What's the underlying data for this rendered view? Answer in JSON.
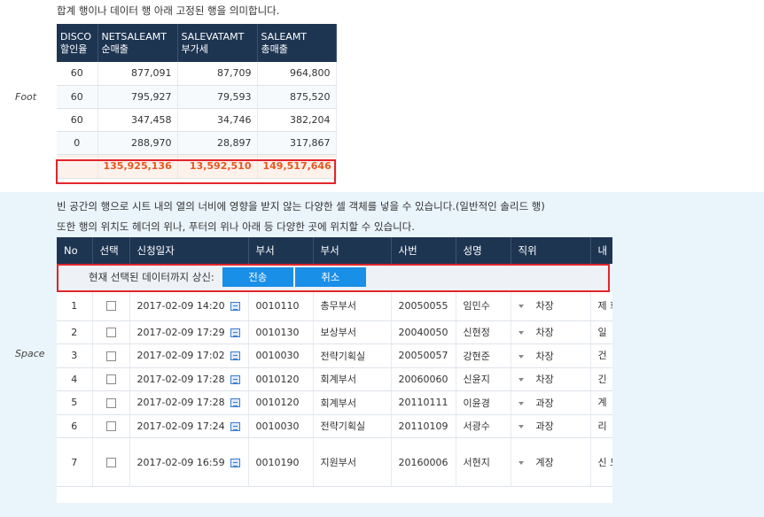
{
  "foot": {
    "section_label": "Foot",
    "description": "합계 행이나 데이터 행 아래 고정된 행을 의미합니다.",
    "headers": [
      {
        "line1": "DISCO",
        "line2": "할인율"
      },
      {
        "line1": "NETSALEAMT",
        "line2": "순매출"
      },
      {
        "line1": "SALEVATAMT",
        "line2": "부가세"
      },
      {
        "line1": "SALEAMT",
        "line2": "총매출"
      }
    ],
    "rows": [
      [
        "60",
        "877,091",
        "87,709",
        "964,800"
      ],
      [
        "60",
        "795,927",
        "79,593",
        "875,520"
      ],
      [
        "60",
        "347,458",
        "34,746",
        "382,204"
      ],
      [
        "0",
        "288,970",
        "28,897",
        "317,867"
      ]
    ],
    "footer": [
      "",
      "135,925,136",
      "13,592,510",
      "149,517,646"
    ]
  },
  "space": {
    "section_label": "Space",
    "description1": "빈 공간의 행으로 시트 내의 열의 너비에 영향을 받지 않는 다양한 셀 객체를 넣을 수 있습니다.(일반적인 솔리드 행)",
    "description2": "또한 행의 위치도 헤더의 위나, 푸터의 위나 아래 등 다양한 곳에 위치할 수 있습니다.",
    "headers": [
      "No",
      "선택",
      "신청일자",
      "부서",
      "부서",
      "사번",
      "성명",
      "직위",
      "내"
    ],
    "space_row_text": "현재 선택된 데이터까지 상신:",
    "send_label": "전송",
    "cancel_label": "취소",
    "rows": [
      {
        "no": "1",
        "date": "2017-02-09 14:20",
        "dept_code": "0010110",
        "dept": "총무부서",
        "emp": "20050055",
        "name": "임민수",
        "pos": "차장",
        "last": "제 회"
      },
      {
        "no": "2",
        "date": "2017-02-09 17:29",
        "dept_code": "0010130",
        "dept": "보상부서",
        "emp": "20040050",
        "name": "신현정",
        "pos": "차장",
        "last": "일"
      },
      {
        "no": "3",
        "date": "2017-02-09 17:02",
        "dept_code": "0010030",
        "dept": "전략기획실",
        "emp": "20050057",
        "name": "강현준",
        "pos": "차장",
        "last": "건"
      },
      {
        "no": "4",
        "date": "2017-02-09 17:28",
        "dept_code": "0010120",
        "dept": "회계부서",
        "emp": "20060060",
        "name": "신윤지",
        "pos": "차장",
        "last": "긴"
      },
      {
        "no": "5",
        "date": "2017-02-09 17:28",
        "dept_code": "0010120",
        "dept": "회계부서",
        "emp": "20110111",
        "name": "이윤경",
        "pos": "과장",
        "last": "계"
      },
      {
        "no": "6",
        "date": "2017-02-09 17:24",
        "dept_code": "0010030",
        "dept": "전략기획실",
        "emp": "20110109",
        "name": "서광수",
        "pos": "과장",
        "last": "리"
      },
      {
        "no": "7",
        "date": "2017-02-09 16:59",
        "dept_code": "0010190",
        "dept": "지원부서",
        "emp": "20160006",
        "name": "서현지",
        "pos": "계장",
        "last": "신 도 별"
      }
    ]
  }
}
